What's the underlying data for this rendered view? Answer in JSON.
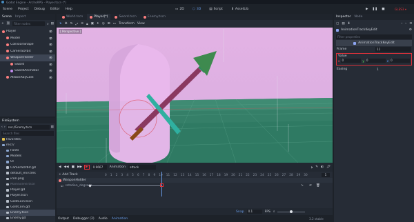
{
  "window": {
    "title": "Godot Engine - ArchoRPG - Player.tscn (*)"
  },
  "menu": [
    "Scene",
    "Project",
    "Debug",
    "Editor",
    "Help"
  ],
  "workspaces": [
    "2D",
    "3D",
    "Script",
    "AssetLib"
  ],
  "scene_tabs": [
    "World.tscn",
    "Player(*)",
    "Sword.tscn",
    "Enemy.tscn"
  ],
  "scene_dock": {
    "tabs": [
      "Scene",
      "Import"
    ],
    "filter_placeholder": "Filter nodes",
    "nodes": [
      {
        "label": "Player",
        "indent": 0,
        "color": "#fc7f7f"
      },
      {
        "label": "Model",
        "indent": 1,
        "color": "#fc7f7f"
      },
      {
        "label": "CollisionShape",
        "indent": 1,
        "color": "#fc7f7f"
      },
      {
        "label": "CameraOrbit",
        "indent": 1,
        "color": "#fc7f7f"
      },
      {
        "label": "WeaponHolder",
        "indent": 1,
        "color": "#fc7f7f",
        "selected": true
      },
      {
        "label": "Sword",
        "indent": 2,
        "color": "#fc7f7f"
      },
      {
        "label": "SwordAnimator",
        "indent": 2,
        "color": "#c38ef1"
      },
      {
        "label": "AttackRayCast",
        "indent": 1,
        "color": "#fc7f7f"
      }
    ]
  },
  "filesystem": {
    "title": "FileSystem",
    "path": "res://Enemy.tscn",
    "search_placeholder": "Search files",
    "items": [
      {
        "label": "Favorites:",
        "indent": 0,
        "kind": "fav"
      },
      {
        "label": "res://",
        "indent": 0,
        "kind": "folder"
      },
      {
        "label": "Fonts",
        "indent": 1,
        "kind": "folder"
      },
      {
        "label": "Models",
        "indent": 1,
        "kind": "folder"
      },
      {
        "label": "UI",
        "indent": 1,
        "kind": "folder"
      },
      {
        "label": "CameraOrbit.gd",
        "indent": 1,
        "kind": "file"
      },
      {
        "label": "default_env.tres",
        "indent": 1,
        "kind": "file"
      },
      {
        "label": "icon.png",
        "indent": 1,
        "kind": "file"
      },
      {
        "label": "MainScene.tscn",
        "indent": 1,
        "kind": "file",
        "dim": true
      },
      {
        "label": "Player.gd",
        "indent": 1,
        "kind": "file"
      },
      {
        "label": "Player.tscn",
        "indent": 1,
        "kind": "file"
      },
      {
        "label": "GoldCoin.tscn",
        "indent": 1,
        "kind": "file"
      },
      {
        "label": "GoldCoin.gd",
        "indent": 1,
        "kind": "file"
      },
      {
        "label": "Enemy.tscn",
        "indent": 1,
        "kind": "file",
        "selected": true
      },
      {
        "label": "Enemy.gd",
        "indent": 1,
        "kind": "file"
      }
    ]
  },
  "viewport": {
    "toolbar_items": [
      "Transform",
      "View"
    ],
    "perspective_label": "[ Perspective ]"
  },
  "animation": {
    "time_value": "0.9667",
    "animation_label": "Animation",
    "animation_name": "attack",
    "add_track": "+ Add Track",
    "track_group": "WeaponHolder",
    "track_name": "rotation_degrees",
    "length": "1",
    "snap_label": "Snap",
    "snap_value": "0.1",
    "fps_label": "FPS",
    "zoom_value": "30",
    "ruler": [
      "0",
      "1",
      "2",
      "3",
      "4",
      "5",
      "6",
      "7",
      "8",
      "9",
      "10",
      "11",
      "12",
      "13",
      "14",
      "15",
      "16",
      "17",
      "18",
      "19",
      "20",
      "21",
      "22",
      "23",
      "24",
      "25",
      "26",
      "27",
      "28",
      "29",
      "30"
    ]
  },
  "bottom_tabs": [
    "Output",
    "Debugger (2)",
    "Audio",
    "Animation"
  ],
  "version": "3.2 stable",
  "inspector": {
    "tabs": [
      "Inspector",
      "Node"
    ],
    "object_name": "AnimationTrackKeyEdit",
    "filter_placeholder": "Filter properties",
    "header": "AnimationTrackKeyEdit",
    "frame_label": "Frame",
    "frame_value": "11",
    "value_label": "Value",
    "value_x": "0",
    "value_y": "0",
    "value_z": "0",
    "easing_label": "Easing",
    "easing_value": "1"
  },
  "colors": {
    "accent": "#699ce8",
    "red": "#e0323a",
    "bg": "#1d2229"
  }
}
